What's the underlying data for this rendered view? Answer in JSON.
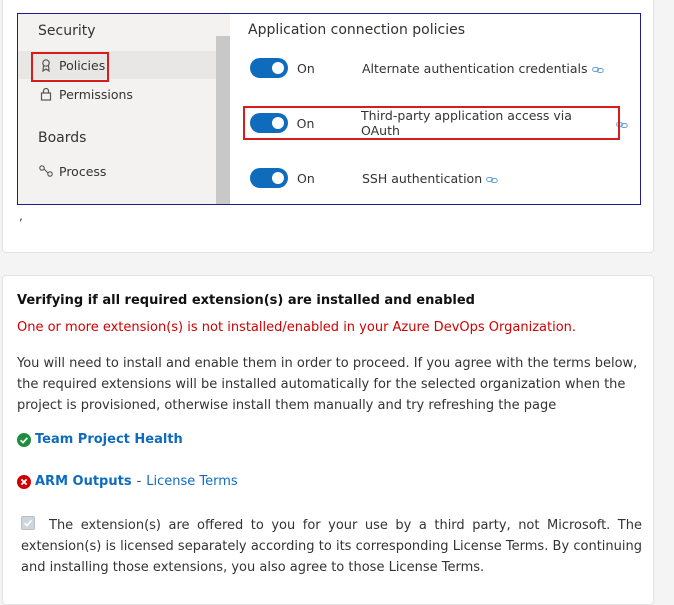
{
  "settings_screenshot": {
    "sidebar": {
      "security_header": "Security",
      "items": [
        {
          "label": "Policies",
          "icon": "policy-icon",
          "active": true
        },
        {
          "label": "Permissions",
          "icon": "lock-icon",
          "active": false
        }
      ],
      "boards_header": "Boards",
      "boards_items": [
        {
          "label": "Process",
          "icon": "process-icon"
        }
      ]
    },
    "main": {
      "title": "Application connection policies",
      "policies": [
        {
          "state": "On",
          "name": "Alternate authentication credentials",
          "enabled": true
        },
        {
          "state": "On",
          "name": "Third-party application access via OAuth",
          "enabled": true
        },
        {
          "state": "On",
          "name": "SSH authentication",
          "enabled": true
        }
      ]
    },
    "colors": {
      "highlight": "#d71c1c",
      "toggle_on": "#0f6cbd",
      "border": "#1d1d8c"
    }
  },
  "trailing_mark": ",",
  "extensions_card": {
    "title": "Verifying if all required extension(s) are installed and enabled",
    "error": "One or more extension(s) is not installed/enabled in your Azure DevOps Organization.",
    "description": "You will need to install and enable them in order to proceed. If you agree with the terms below, the required extensions will be installed automatically for the selected organization when the project is provisioned, otherwise install them manually and try refreshing the page",
    "extensions": [
      {
        "name": "Team Project Health",
        "status": "installed",
        "icon": "check-circle-icon"
      },
      {
        "name": "ARM Outputs",
        "status": "missing",
        "icon": "error-circle-icon",
        "separator": "-",
        "license_link": "License Terms"
      }
    ],
    "consent_text": "The extension(s) are offered to you for your use by a third party, not Microsoft. The extension(s) is licensed separately according to its corresponding License Terms. By continuing and installing those extensions, you also agree to those License Terms.",
    "consent_checked": true,
    "colors": {
      "error": "#d10000",
      "link": "#0f6cbd",
      "success": "#1e8e3e"
    }
  }
}
